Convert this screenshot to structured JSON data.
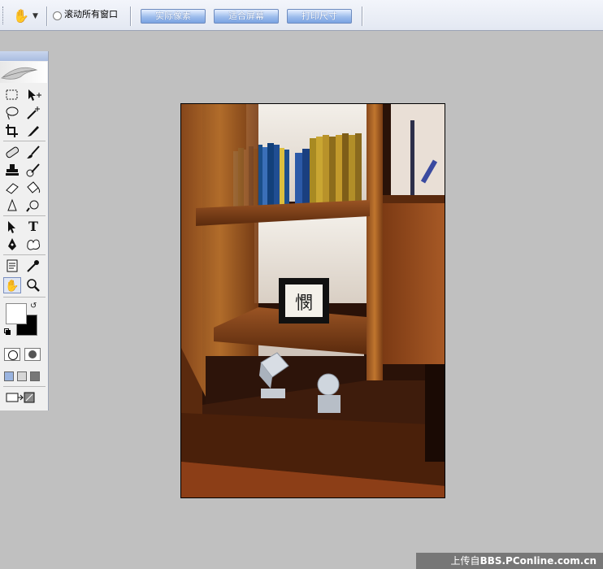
{
  "options_bar": {
    "scroll_all_windows_label": "滚动所有窗口",
    "actual_pixels_label": "实际像素",
    "fit_screen_label": "适合屏幕",
    "print_size_label": "打印尺寸"
  },
  "toolbox": {
    "tools": [
      "rectangular-marquee-icon",
      "move-icon",
      "lasso-icon",
      "magic-wand-icon",
      "crop-icon",
      "slice-icon",
      "healing-brush-icon",
      "brush-icon",
      "clone-stamp-icon",
      "history-brush-icon",
      "eraser-icon",
      "paint-bucket-icon",
      "blur-icon",
      "dodge-icon",
      "path-selection-icon",
      "type-icon",
      "pen-icon",
      "custom-shape-icon",
      "notes-icon",
      "eyedropper-icon",
      "hand-icon",
      "zoom-icon"
    ],
    "type_tool_glyph": "T",
    "foreground_color": "#ffffff",
    "background_color": "#000000"
  },
  "image": {
    "frame_text": "憫"
  },
  "watermark": {
    "prefix": "上传自",
    "site": "BBS.PConline.com.cn"
  }
}
